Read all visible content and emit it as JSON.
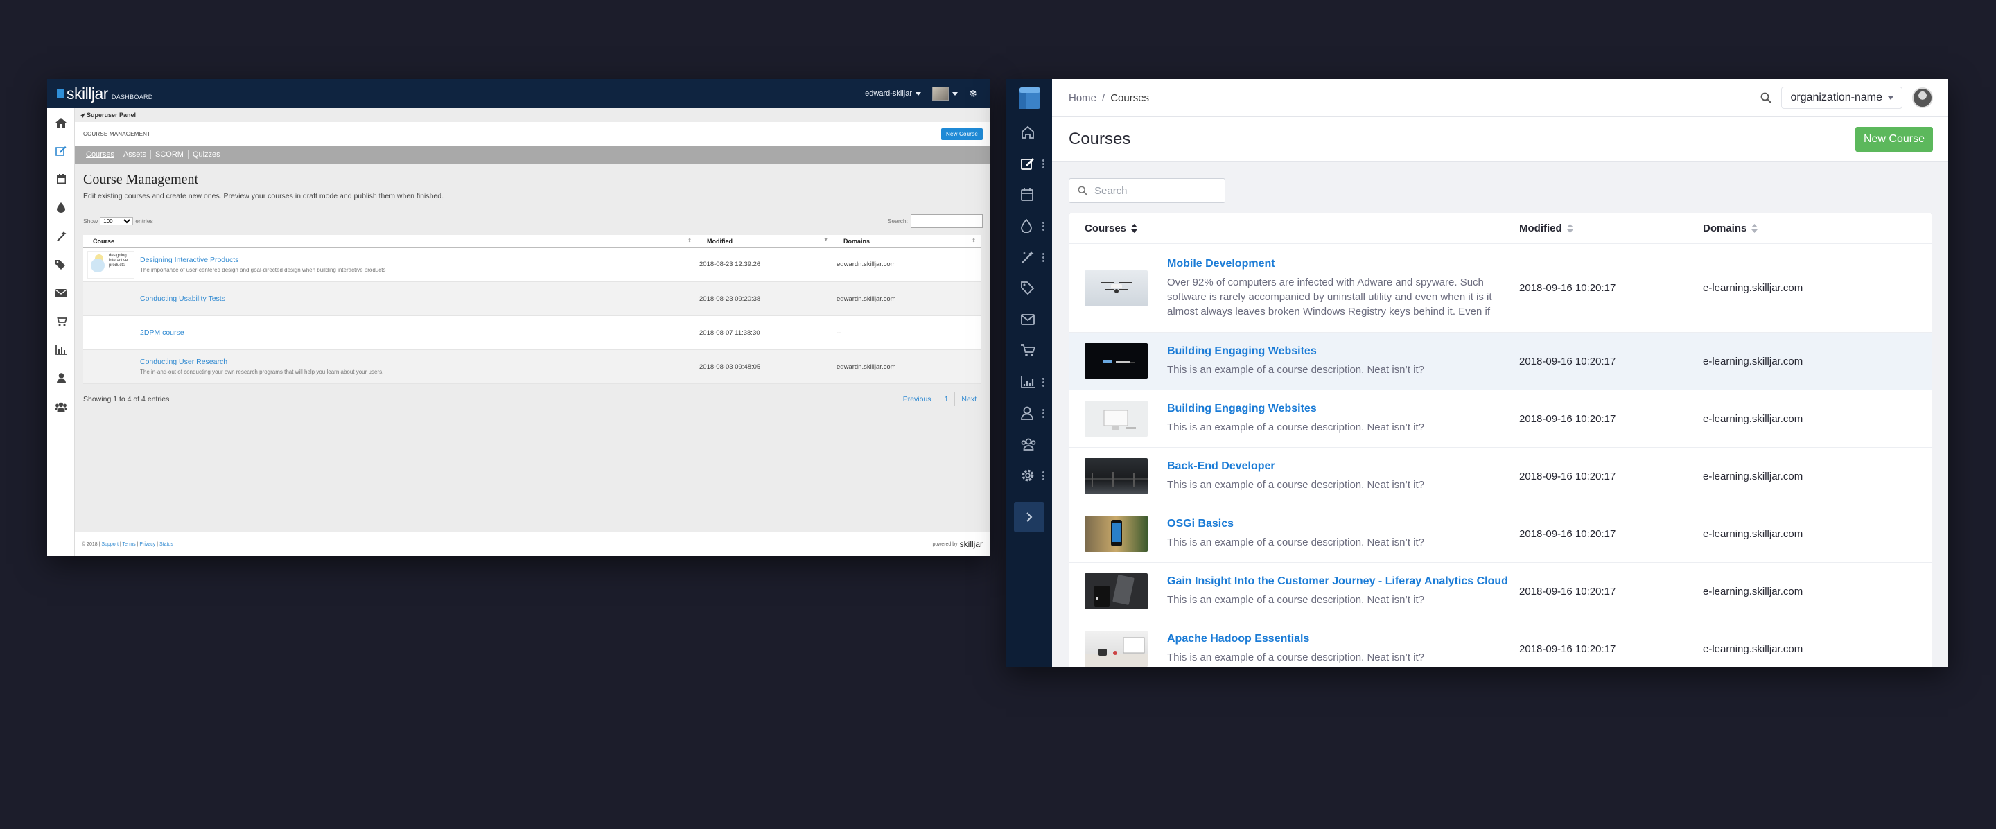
{
  "old_dashboard": {
    "brand": "skilljar",
    "brand_sub": "DASHBOARD",
    "user": "edward-skiljar",
    "breadcrumb": "Superuser Panel",
    "section_label": "COURSE MANAGEMENT",
    "new_course_label": "New Course",
    "tabs": [
      "Courses",
      "Assets",
      "SCORM",
      "Quizzes"
    ],
    "title": "Course Management",
    "description": "Edit existing courses and create new ones. Preview your courses in draft mode and publish them when finished.",
    "show_label": "Show",
    "show_value": "100",
    "entries_label": "entries",
    "search_label": "Search:",
    "columns": [
      "Course",
      "Modified",
      "Domains"
    ],
    "rows": [
      {
        "title": "Designing Interactive Products",
        "subtitle": "The importance of user-centered design and goal-directed design when building interactive products",
        "thumb_text": "designing interactive products",
        "modified": "2018-08-23 12:39:26",
        "domain": "edwardn.skilljar.com"
      },
      {
        "title": "Conducting Usability Tests",
        "subtitle": "",
        "thumb_text": "",
        "modified": "2018-08-23 09:20:38",
        "domain": "edwardn.skilljar.com"
      },
      {
        "title": "2DPM course",
        "subtitle": "",
        "thumb_text": "",
        "modified": "2018-08-07 11:38:30",
        "domain": "--"
      },
      {
        "title": "Conducting User Research",
        "subtitle": "The in-and-out of conducting your own research programs that will help you learn about your users.",
        "thumb_text": "",
        "modified": "2018-08-03 09:48:05",
        "domain": "edwardn.skilljar.com"
      }
    ],
    "showing": "Showing 1 to 4 of 4 entries",
    "pager": {
      "prev": "Previous",
      "page": "1",
      "next": "Next"
    },
    "footer": {
      "copyright": "© 2018 |",
      "support": "Support",
      "terms": "Terms",
      "privacy": "Privacy",
      "status": "Status",
      "powered": "powered by",
      "powered_brand": "skilljar"
    }
  },
  "new_ui": {
    "breadcrumb": [
      "Home",
      "Courses"
    ],
    "breadcrumb_sep": "/",
    "org": "organization-name",
    "page_title": "Courses",
    "new_course_label": "New Course",
    "search_placeholder": "Search",
    "columns": [
      "Courses",
      "Modified",
      "Domains"
    ],
    "sidebar_icons": [
      "home-icon",
      "edit-icon",
      "calendar-icon",
      "drop-icon",
      "magic-wand-icon",
      "tag-icon",
      "mail-icon",
      "cart-icon",
      "chart-icon",
      "user-icon",
      "users-icon",
      "gear-icon"
    ],
    "rows": [
      {
        "title": "Mobile Development",
        "desc": "Over 92% of computers are infected with Adware and spyware. Such software is rarely accompanied by uninstall utility and even when it is it almost always leaves broken Windows Registry keys behind it. Even if",
        "modified": "2018-09-16 10:20:17",
        "domain": "e-learning.skilljar.com"
      },
      {
        "title": "Building Engaging Websites",
        "desc": "This is an example of a course description. Neat isn’t it?",
        "modified": "2018-09-16 10:20:17",
        "domain": "e-learning.skilljar.com"
      },
      {
        "title": "Building Engaging Websites",
        "desc": "This is an example of a course description. Neat isn’t it?",
        "modified": "2018-09-16 10:20:17",
        "domain": "e-learning.skilljar.com"
      },
      {
        "title": "Back-End Developer",
        "desc": "This is an example of a course description. Neat isn’t it?",
        "modified": "2018-09-16 10:20:17",
        "domain": "e-learning.skilljar.com"
      },
      {
        "title": "OSGi Basics",
        "desc": "This is an example of a course description. Neat isn’t it?",
        "modified": "2018-09-16 10:20:17",
        "domain": "e-learning.skilljar.com"
      },
      {
        "title": "Gain Insight Into the Customer Journey - Liferay Analytics Cloud",
        "desc": "This is an example of a course description. Neat isn’t it?",
        "modified": "2018-09-16 10:20:17",
        "domain": "e-learning.skilljar.com"
      },
      {
        "title": "Apache Hadoop Essentials",
        "desc": "This is an example of a course description. Neat isn’t it?",
        "modified": "2018-09-16 10:20:17",
        "domain": "e-learning.skilljar.com"
      }
    ]
  },
  "colors": {
    "background": "#1c1d2b",
    "old_topbar": "#0f2440",
    "old_link": "#2f89d1",
    "new_sidebar": "#0d1e36",
    "new_link": "#1a7bd6",
    "new_button": "#5cb85c"
  }
}
